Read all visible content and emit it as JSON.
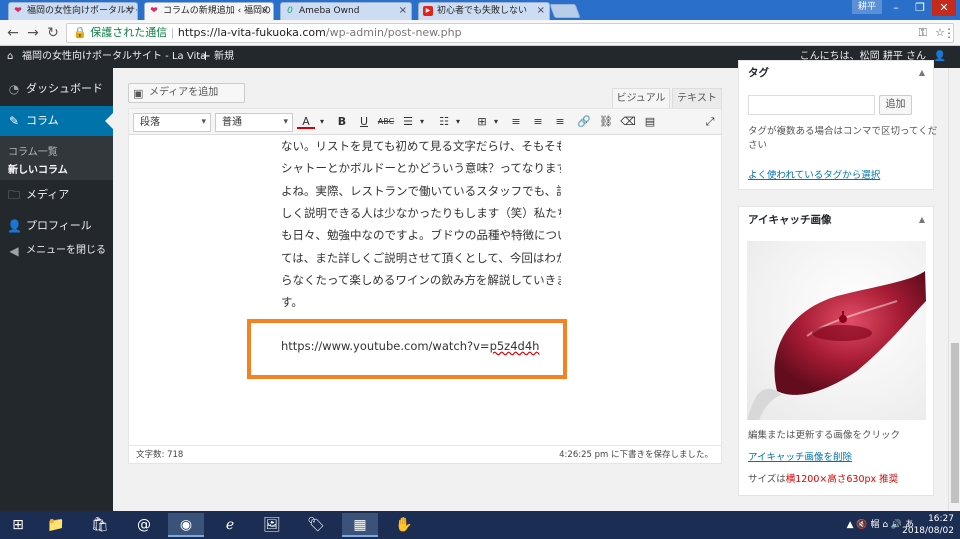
{
  "browser": {
    "tabs": [
      {
        "title": "福岡の女性向けポータルサイ",
        "icon": "heart-icon",
        "active": false
      },
      {
        "title": "コラムの新規追加 ‹ 福岡の",
        "icon": "heart-icon",
        "active": true
      },
      {
        "title": "Ameba Ownd",
        "icon": "ameba-icon",
        "active": false
      },
      {
        "title": "初心者でも失敗しない",
        "icon": "youtube-icon",
        "active": false
      }
    ],
    "user_badge": "耕平",
    "secure_label": "保護された通信",
    "url_host": "https://la-vita-fukuoka.com",
    "url_path": "/wp-admin/post-new.php"
  },
  "adminbar": {
    "site_name": "福岡の女性向けポータルサイト - La Vita",
    "new_label": "新規",
    "greeting": "こんにちは、松岡 耕平 さん"
  },
  "sidebar": {
    "items": [
      {
        "label": "ダッシュボード",
        "icon": "dashboard-icon"
      },
      {
        "label": "コラム",
        "icon": "pin-icon"
      },
      {
        "label": "メディア",
        "icon": "media-icon"
      },
      {
        "label": "プロフィール",
        "icon": "user-icon"
      },
      {
        "label": "メニューを閉じる",
        "icon": "collapse-icon"
      }
    ],
    "submenu": [
      "コラム一覧",
      "新しいコラム"
    ]
  },
  "editor": {
    "add_media": "メディアを追加",
    "tab_visual": "ビジュアル",
    "tab_text": "テキスト",
    "format_select": "段落",
    "font_select": "普通",
    "paragraph_lines": [
      "ない。リストを見ても初めて見る文字だらけ、そもそも",
      "シャトーとかボルドーとかどういう意味？ってなります",
      "よね。実際、レストランで働いているスタッフでも、詳",
      "しく説明できる人は少なかったりもします（笑）私たち",
      "も日々、勉強中なのですよ。ブドウの品種や特徴につい",
      "ては、また詳しくご説明させて頂くとして、今回はわか",
      "らなくたって楽しめるワインの飲み方を解説していきま",
      "す。"
    ],
    "youtube_url_plain": "https://www.youtube.com/watch?v=",
    "youtube_url_id": "p5z4d4h",
    "word_count": "文字数: 718",
    "draft_saved": "4:26:25 pm に下書きを保存しました。"
  },
  "tags_box": {
    "title": "タグ",
    "add_button": "追加",
    "help_line1": "タグが複数ある場合はコンマで区切ってくだ",
    "help_line2": "さい",
    "popular_link": "よく使われているタグから選択"
  },
  "featured_box": {
    "title": "アイキャッチ画像",
    "click_text": "編集または更新する画像をクリック",
    "remove_link": "アイキャッチ画像を削除",
    "size_prefix": "サイズは",
    "size_value": "横1200×高さ630px 推奨"
  },
  "taskbar": {
    "tray_text": "▲ 🔇 帽 ⌂ 🔊 あ",
    "time": "16:27",
    "date": "2018/08/02"
  },
  "colors": {
    "wp_blue": "#0073aa",
    "admin_dark": "#23282d",
    "highlight_orange": "#f58220",
    "wine_red": "#a3102a"
  }
}
